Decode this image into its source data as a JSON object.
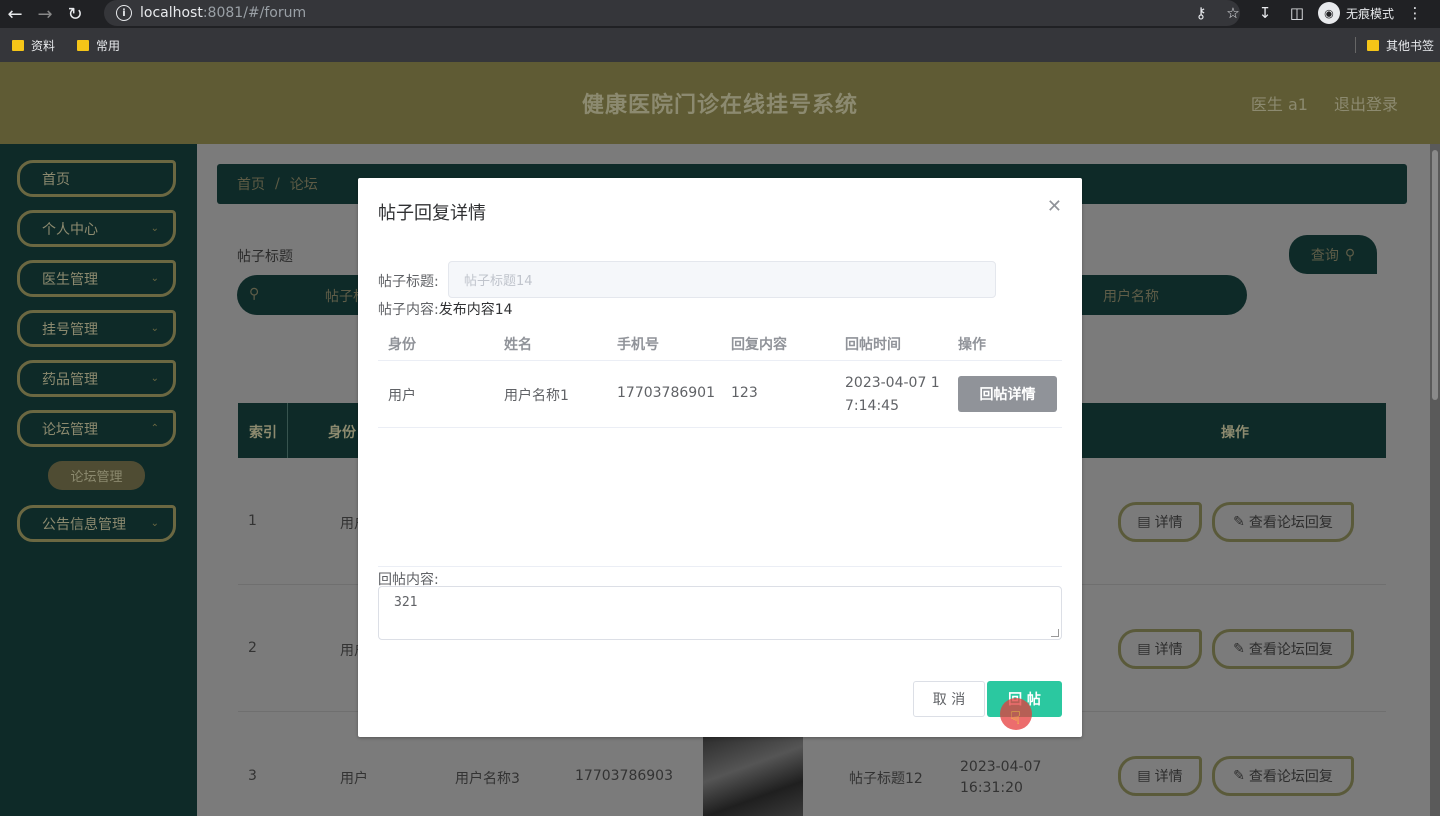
{
  "browser": {
    "url_host": "localhost",
    "url_rest": ":8081/#/forum",
    "incognito_label": "无痕模式",
    "bookmarks": [
      "资料",
      "常用"
    ],
    "other_bookmarks": "其他书签"
  },
  "header": {
    "title": "健康医院门诊在线挂号系统",
    "user": "医生 a1",
    "logout": "退出登录"
  },
  "sidebar": {
    "items": [
      {
        "label": "首页"
      },
      {
        "label": "个人中心"
      },
      {
        "label": "医生管理"
      },
      {
        "label": "挂号管理"
      },
      {
        "label": "药品管理"
      },
      {
        "label": "论坛管理"
      },
      {
        "label": "公告信息管理"
      }
    ],
    "sub_item": "论坛管理"
  },
  "main": {
    "breadcrumb_home": "首页",
    "breadcrumb_sep": "/",
    "breadcrumb_current": "论坛",
    "search_label": "帖子标题",
    "search_placeholder_1": "帖子标",
    "search_placeholder_2": "用户名称",
    "query_button": "查询",
    "table_headers": {
      "index": "索引",
      "identity": "身份",
      "op": "操作"
    },
    "rows": [
      {
        "index": "1",
        "identity": "用户"
      },
      {
        "index": "2",
        "identity": "用户"
      },
      {
        "index": "3",
        "identity": "用户",
        "name": "用户名称3",
        "phone": "17703786903",
        "title": "帖子标题12",
        "time": "2023-04-07 16:31:20"
      }
    ],
    "detail_button": "详情",
    "view_reply_button": "查看论坛回复"
  },
  "dialog": {
    "title": "帖子回复详情",
    "post_title_label": "帖子标题:",
    "post_title_value": "帖子标题14",
    "post_content_label": "帖子内容:",
    "post_content_value": "发布内容14",
    "columns": [
      "身份",
      "姓名",
      "手机号",
      "回复内容",
      "回帖时间",
      "操作"
    ],
    "reply": {
      "identity": "用户",
      "name": "用户名称1",
      "phone": "17703786901",
      "content": "123",
      "time": "2023-04-07 17:14:45",
      "action": "回帖详情"
    },
    "reply_content_label": "回帖内容:",
    "reply_content_value": "321",
    "cancel_button": "取 消",
    "reply_button": "回 帖"
  }
}
